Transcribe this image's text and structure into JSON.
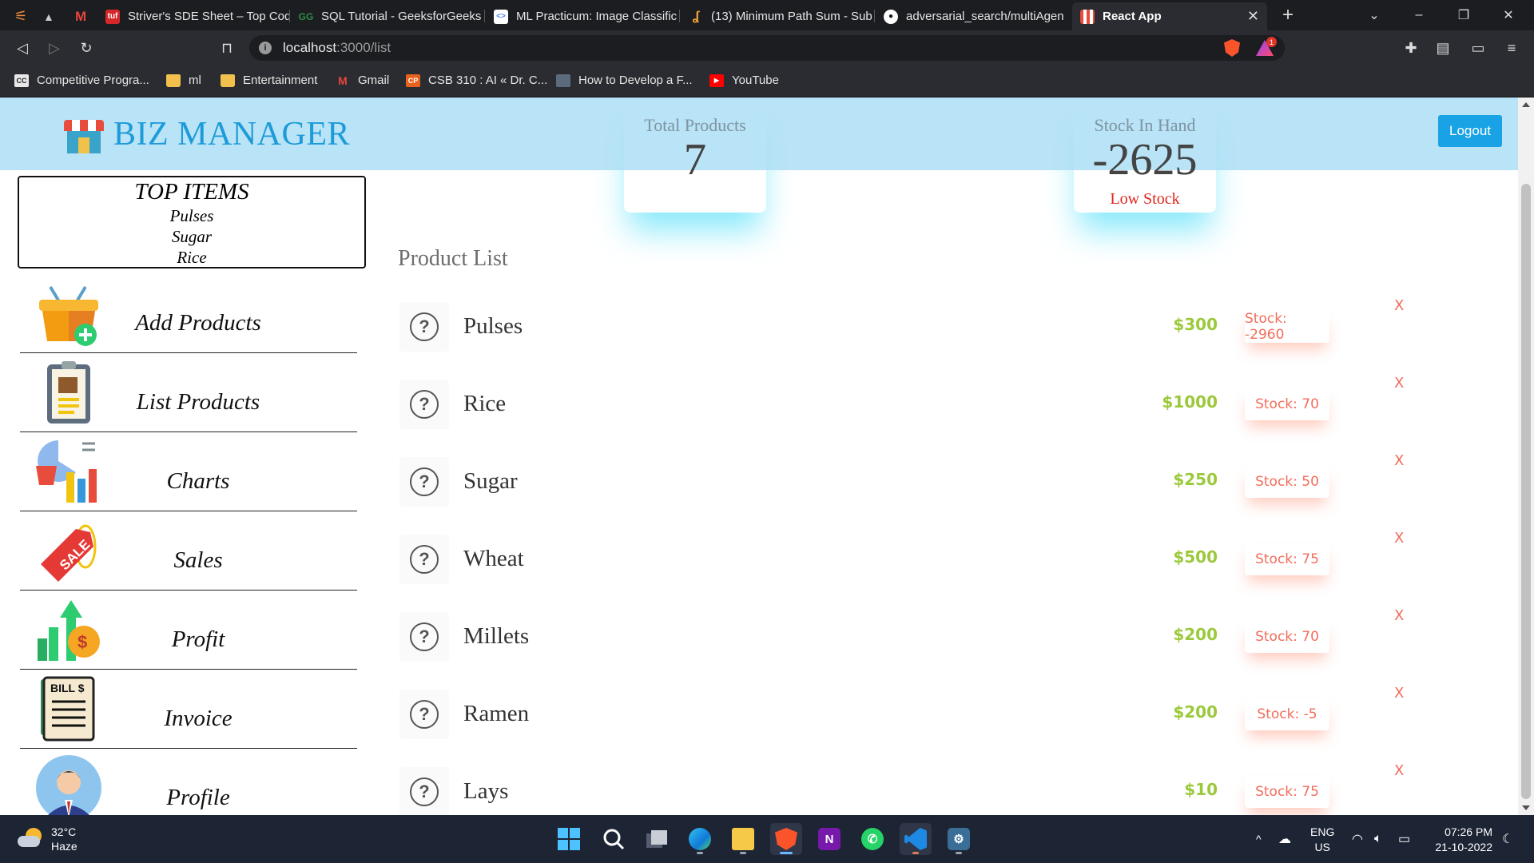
{
  "browser": {
    "tabs": [
      {
        "title": "Striver's SDE Sheet – Top Codi",
        "favicon": "striver-icon",
        "active": false
      },
      {
        "title": "SQL Tutorial - GeeksforGeeks",
        "favicon": "gfg-icon",
        "active": false
      },
      {
        "title": "ML Practicum: Image Classific",
        "favicon": "google-dev-icon",
        "active": false
      },
      {
        "title": "(13) Minimum Path Sum - Sub",
        "favicon": "leetcode-icon",
        "active": false
      },
      {
        "title": "adversarial_search/multiAgen",
        "favicon": "github-icon",
        "active": false
      },
      {
        "title": "React App",
        "favicon": "react-app-shop-icon",
        "active": true
      }
    ],
    "url_host": "localhost",
    "url_path": ":3000/list",
    "bookmarks": [
      {
        "label": "Competitive Progra...",
        "icon": "cc-icon"
      },
      {
        "label": "ml",
        "icon": "folder-icon"
      },
      {
        "label": "Entertainment",
        "icon": "folder-icon"
      },
      {
        "label": "Gmail",
        "icon": "gmail-icon"
      },
      {
        "label": "CSB 310 : AI « Dr. C...",
        "icon": "cp-icon"
      },
      {
        "label": "How to Develop a F...",
        "icon": "site-icon"
      },
      {
        "label": "YouTube",
        "icon": "youtube-icon"
      }
    ],
    "rewards_badge": "1"
  },
  "app": {
    "brand": "BIZ MANAGER",
    "logout_label": "Logout",
    "stats": {
      "total_products_label": "Total Products",
      "total_products_value": "7",
      "stock_label": "Stock In Hand",
      "stock_value": "-2625",
      "stock_note": "Low Stock"
    },
    "top_items": {
      "heading": "TOP ITEMS",
      "items": [
        "Pulses",
        "Sugar",
        "Rice"
      ]
    },
    "nav": [
      {
        "label": "Add Products",
        "icon": "add-basket-icon"
      },
      {
        "label": "List Products",
        "icon": "clipboard-list-icon"
      },
      {
        "label": "Charts",
        "icon": "charts-icon"
      },
      {
        "label": "Sales",
        "icon": "sale-tag-icon"
      },
      {
        "label": "Profit",
        "icon": "profit-arrow-icon"
      },
      {
        "label": "Invoice",
        "icon": "bill-icon"
      },
      {
        "label": "Profile",
        "icon": "user-avatar-icon"
      }
    ],
    "section_title": "Product List",
    "products": [
      {
        "name": "Pulses",
        "price": "$300",
        "stock": "Stock: -2960",
        "delete": "X"
      },
      {
        "name": "Rice",
        "price": "$1000",
        "stock": "Stock: 70",
        "delete": "X"
      },
      {
        "name": "Sugar",
        "price": "$250",
        "stock": "Stock: 50",
        "delete": "X"
      },
      {
        "name": "Wheat",
        "price": "$500",
        "stock": "Stock: 75",
        "delete": "X"
      },
      {
        "name": "Millets",
        "price": "$200",
        "stock": "Stock: 70",
        "delete": "X"
      },
      {
        "name": "Ramen",
        "price": "$200",
        "stock": "Stock: -5",
        "delete": "X"
      },
      {
        "name": "Lays",
        "price": "$10",
        "stock": "Stock: 75",
        "delete": "X"
      }
    ],
    "colors": {
      "header": "#b5e2f7",
      "brand": "#1d9bd9",
      "price": "#9bc93b",
      "stock_text": "#f26d5b",
      "low_stock": "#e2241b",
      "logout": "#19a3e6"
    }
  },
  "taskbar": {
    "weather_temp": "32°C",
    "weather_desc": "Haze",
    "lang_line1": "ENG",
    "lang_line2": "US",
    "time": "07:26 PM",
    "date": "21-10-2022"
  }
}
